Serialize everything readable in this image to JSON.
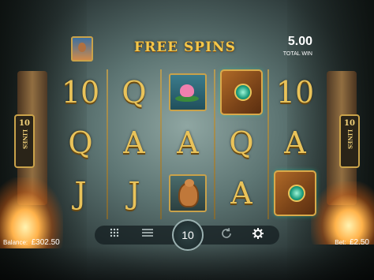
{
  "header": {
    "title": "FREE SPINS",
    "win_amount": "5.00",
    "win_label": "TOTAL WIN"
  },
  "paylines": {
    "left_count": "10",
    "left_word": "LINES",
    "right_count": "10",
    "right_word": "LINES"
  },
  "reels": [
    [
      "10",
      "Q",
      "J"
    ],
    [
      "Q",
      "A",
      "J"
    ],
    [
      "lotus",
      "A",
      "snake"
    ],
    [
      "book",
      "Q",
      "A"
    ],
    [
      "10",
      "A",
      "book"
    ]
  ],
  "controls": {
    "menu_icon": "grid-menu-icon",
    "autoplay_icon": "autoplay-icon",
    "spin_value": "10",
    "refresh_icon": "refresh-icon",
    "settings_icon": "gear-icon"
  },
  "footer": {
    "balance_label": "Balance:",
    "balance_value": "£302.50",
    "bet_label": "Bet:",
    "bet_value": "£2.50"
  },
  "colors": {
    "gold": "#e9c35a",
    "title_gold": "#f5c84a",
    "teal": "#1a9a7a"
  }
}
